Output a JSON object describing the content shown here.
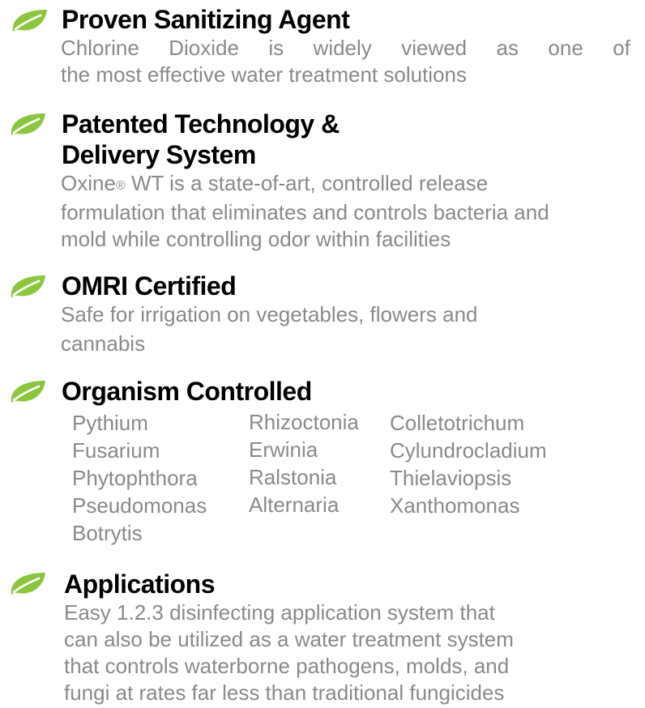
{
  "colors": {
    "leaf_green": "#8cc63f",
    "heading": "#000000",
    "body_text": "#8a8a8a"
  },
  "icons": {
    "bullet": "leaf-icon"
  },
  "sections": [
    {
      "title": "Proven Sanitizing Agent",
      "description_lines": [
        [
          "Chlorine",
          "Dioxide",
          "is",
          "widely",
          "viewed",
          "as",
          "one",
          "of"
        ],
        "the most effective water treatment solutions"
      ]
    },
    {
      "title_lines": [
        "Patented Technology &",
        "Delivery System"
      ],
      "description_lines": [
        {
          "prefix": "Oxine",
          "mark": "®",
          "suffix": " WT is a state-of-art, controlled release"
        },
        "formulation that eliminates and controls bacteria and",
        "mold while controlling odor within facilities"
      ]
    },
    {
      "title": "OMRI Certified",
      "description_lines": [
        "Safe for irrigation on vegetables, flowers and",
        "cannabis"
      ]
    },
    {
      "title": "Organism Controlled",
      "organism_columns": [
        [
          "Pythium",
          "Fusarium",
          "Phytophthora",
          "Pseudomonas",
          "Botrytis"
        ],
        [
          "Rhizoctonia",
          "Erwinia",
          "Ralstonia",
          "Alternaria"
        ],
        [
          "Colletotrichum",
          "Cylundrocladium",
          "Thielaviopsis",
          "Xanthomonas"
        ]
      ]
    },
    {
      "title": "Applications",
      "description_lines": [
        "Easy 1.2.3 disinfecting application system that",
        "can also be utilized as a water treatment system",
        "that controls waterborne pathogens, molds, and",
        "fungi at rates far less than traditional fungicides"
      ]
    }
  ]
}
